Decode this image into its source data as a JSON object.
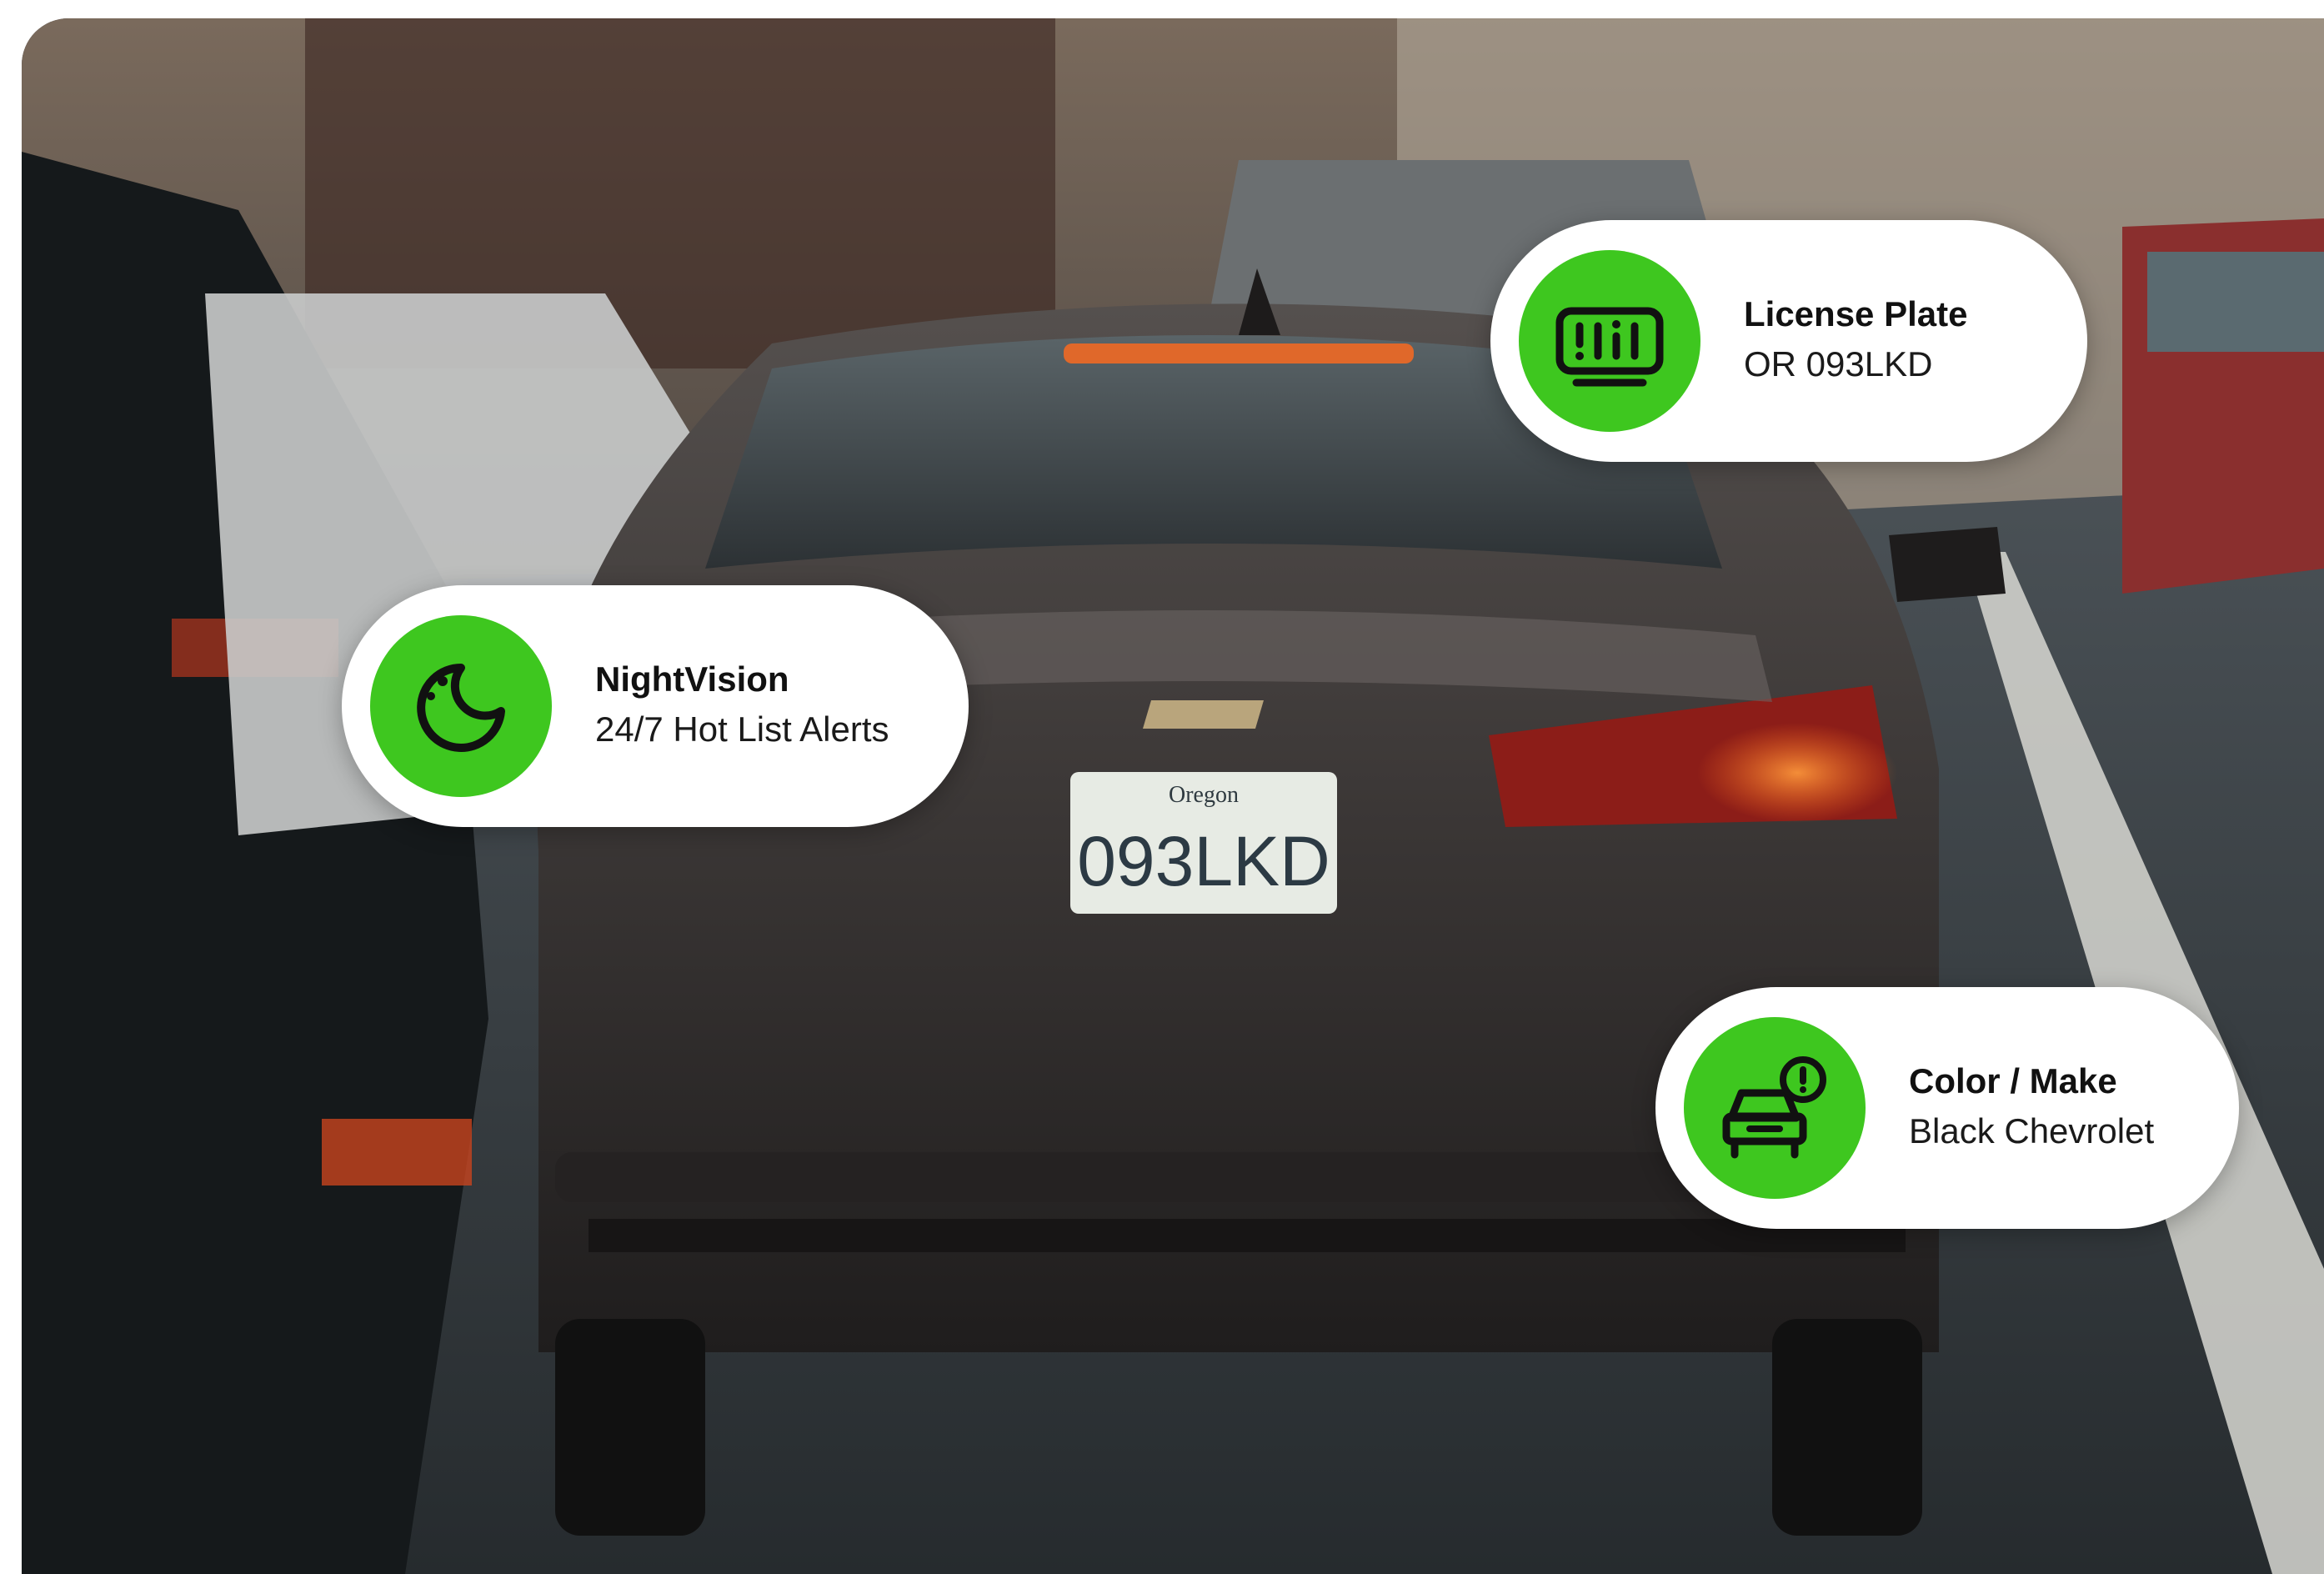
{
  "cards": {
    "license_plate": {
      "title": "License Plate",
      "value": "OR 093LKD",
      "icon": "license-plate-icon"
    },
    "night_vision": {
      "title": "NightVision",
      "value": "24/7 Hot List Alerts",
      "icon": "moon-icon"
    },
    "color_make": {
      "title": "Color / Make",
      "value": "Black Chevrolet",
      "icon": "car-alert-icon"
    }
  },
  "scene": {
    "plate_state": "Oregon",
    "plate_number": "093LKD"
  },
  "colors": {
    "accent": "#3ec71f",
    "card_bg": "#ffffff",
    "text": "#111111"
  }
}
